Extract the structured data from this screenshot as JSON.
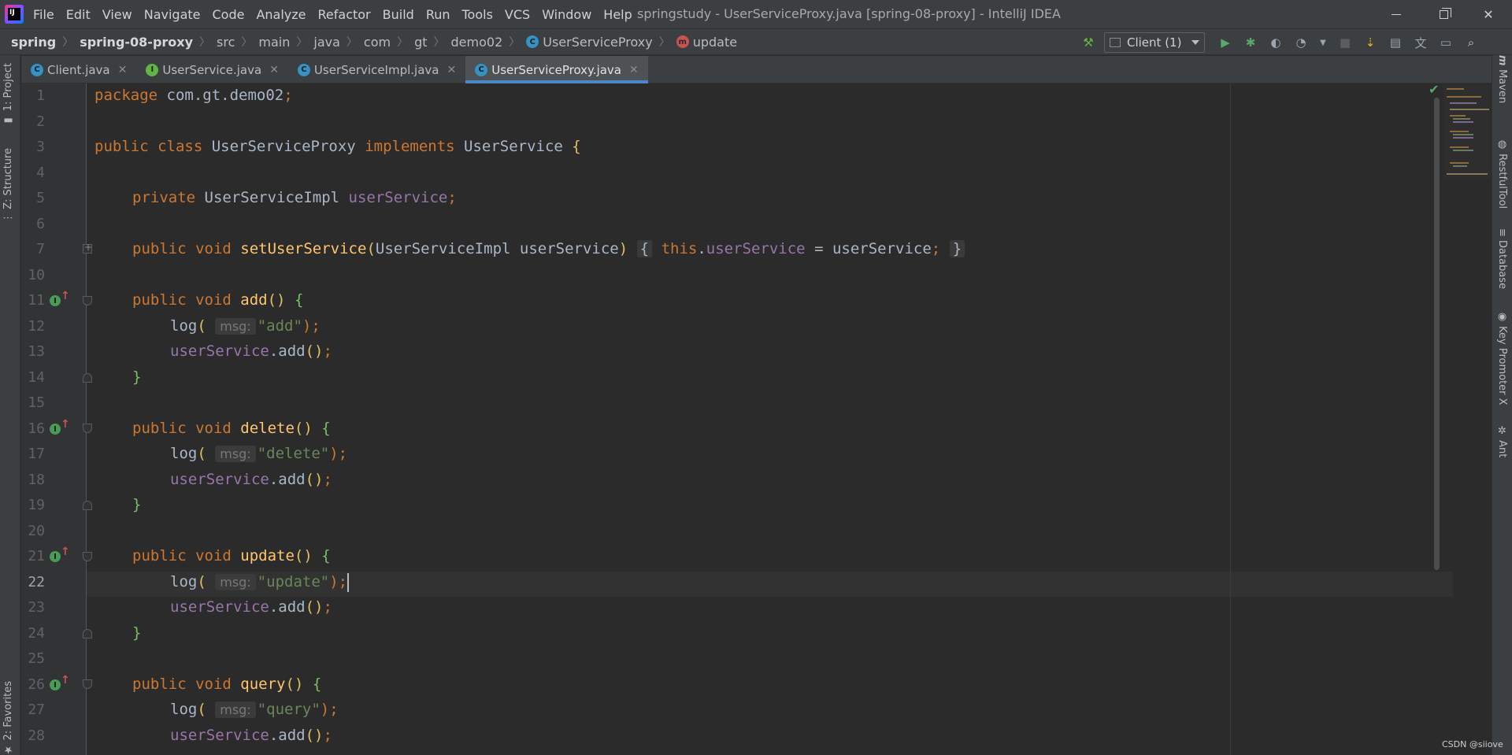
{
  "titlebar": {
    "menu": [
      "File",
      "Edit",
      "View",
      "Navigate",
      "Code",
      "Analyze",
      "Refactor",
      "Build",
      "Run",
      "Tools",
      "VCS",
      "Window",
      "Help"
    ],
    "window_title": "springstudy - UserServiceProxy.java [spring-08-proxy] - IntelliJ IDEA",
    "logo_text": "IJ"
  },
  "breadcrumb": {
    "items": [
      "spring",
      "spring-08-proxy",
      "src",
      "main",
      "java",
      "com",
      "gt",
      "demo02",
      "UserServiceProxy",
      "update"
    ]
  },
  "toolbar": {
    "run_config": "Client (1)",
    "icons": [
      "hammer-icon",
      "run-icon",
      "debug-icon",
      "coverage-icon",
      "profile-icon",
      "stop-icon",
      "vcs-update-icon",
      "project-structure-icon",
      "translate-icon",
      "layout-icon",
      "search-icon"
    ]
  },
  "left_stripe": {
    "project": "1: Project",
    "structure": "Z: Structure",
    "favorites": "2: Favorites"
  },
  "right_stripe": {
    "maven": "Maven",
    "restful": "RestfulTool",
    "database": "Database",
    "key_promoter": "Key Promoter X",
    "ant": "Ant"
  },
  "tabs": [
    {
      "label": "Client.java",
      "icon": "C",
      "active": false
    },
    {
      "label": "UserService.java",
      "icon": "I",
      "active": false
    },
    {
      "label": "UserServiceImpl.java",
      "icon": "C",
      "active": false
    },
    {
      "label": "UserServiceProxy.java",
      "icon": "C",
      "active": true
    }
  ],
  "editor": {
    "line_numbers": [
      "1",
      "2",
      "3",
      "4",
      "5",
      "6",
      "7",
      "10",
      "11",
      "12",
      "13",
      "14",
      "15",
      "16",
      "17",
      "18",
      "19",
      "20",
      "21",
      "22",
      "23",
      "24",
      "25",
      "26",
      "27",
      "28"
    ],
    "current_line": "22",
    "code": {
      "l1_kw": "package",
      "l1_rest": " com.gt.demo02",
      "l1_semi": ";",
      "l3_kw1": "public class",
      "l3_name": " UserServiceProxy ",
      "l3_kw2": "implements",
      "l3_iface": " UserService ",
      "l3_brace": "{",
      "l5_kw": "private",
      "l5_type": " UserServiceImpl ",
      "l5_field": "userService",
      "l5_semi": ";",
      "l7_kw": "public void",
      "l7_fn": " setUserService",
      "l7_paren_open": "(",
      "l7_params": "UserServiceImpl userService",
      "l7_paren_close": ")",
      "l7_open": "{",
      "l7_this": "this",
      "l7_dot": ".",
      "l7_field": "userService",
      "l7_assign": " = userService",
      "l7_semi": ";",
      "l7_close": "}",
      "method_kw": "public void",
      "add_fn": " add",
      "delete_fn": " delete",
      "update_fn": " update",
      "query_fn": " query",
      "parens": "()",
      "open_brace": "{",
      "close_brace": "}",
      "log_fn": "log",
      "paren_open": "(",
      "paren_close_semi": ");",
      "hint": "msg:",
      "str_add": "\"add\"",
      "str_delete": "\"delete\"",
      "str_update": "\"update\"",
      "str_query": "\"query\"",
      "field_call": "userService",
      "call_add": ".add",
      "call_parens": "()",
      "semi": ";"
    }
  },
  "watermark": "CSDN @siiove",
  "colors": {
    "keyword": "#cc7832",
    "function": "#ffc66d",
    "field": "#9876aa",
    "string": "#6a8759",
    "plain": "#a9b7c6",
    "active_tab_underline": "#4a88c7"
  }
}
